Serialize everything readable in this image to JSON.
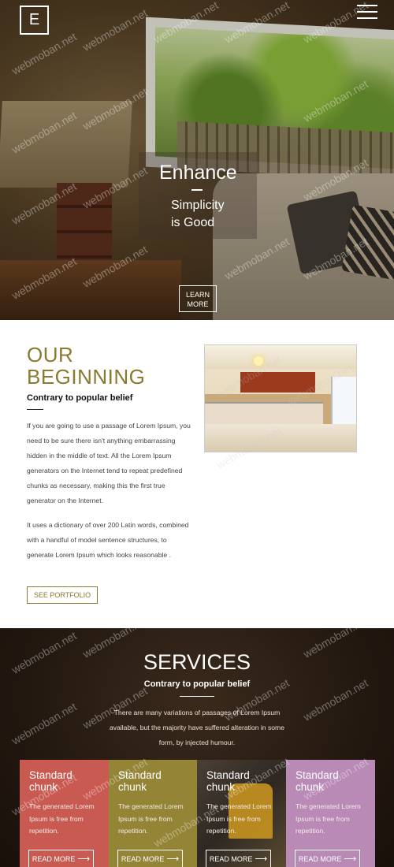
{
  "header": {
    "logo_letter": "E",
    "menu_icon": "hamburger-menu-icon"
  },
  "hero": {
    "title": "Enhance",
    "subtitle_line1": "Simplicity",
    "subtitle_line2": "is Good",
    "learn_more_line1": "LEARN",
    "learn_more_line2": "MORE"
  },
  "about": {
    "title_line1": "OUR",
    "title_line2": "BEGINNING",
    "subtitle": "Contrary to popular belief",
    "paragraph1": "If you are going to use a passage of Lorem Ipsum, you need to be sure there isn't anything embarrassing hidden in the middle of text. All the Lorem Ipsum generators on the Internet tend to repeat predefined chunks as necessary, making this the first true generator on the Internet.",
    "paragraph2": "It uses a dictionary of over 200 Latin words, combined with a handful of model sentence structures, to generate Lorem Ipsum which looks reasonable .",
    "button": "SEE PORTFOLIO"
  },
  "services": {
    "title": "SERVICES",
    "subtitle": "Contrary to popular belief",
    "paragraph": "There are many variations of passages of Lorem Ipsum available, but the majority have suffered alteration in some form, by injected humour.",
    "cards": [
      {
        "title_line1": "Standard",
        "title_line2": "chunk",
        "text": "The generated Lorem Ipsum is free from repetition.",
        "button": "READ MORE",
        "color": "#c95a52"
      },
      {
        "title_line1": "Standard",
        "title_line2": "chunk",
        "text": "The generated Lorem Ipsum is free from repetition.",
        "button": "READ MORE",
        "color": "#938436"
      },
      {
        "title_line1": "Standard",
        "title_line2": "chunk",
        "text": "The generated Lorem Ipsum is free from repetition.",
        "button": "READ MORE",
        "color": "#3a3028"
      },
      {
        "title_line1": "Standard",
        "title_line2": "chunk",
        "text": "The generated Lorem Ipsum is free from repetition.",
        "button": "READ MORE",
        "color": "#b98ab6"
      }
    ]
  },
  "watermark": "webmoban.net",
  "colors": {
    "accent": "#8a7a2e",
    "services_bg": "#231810"
  }
}
